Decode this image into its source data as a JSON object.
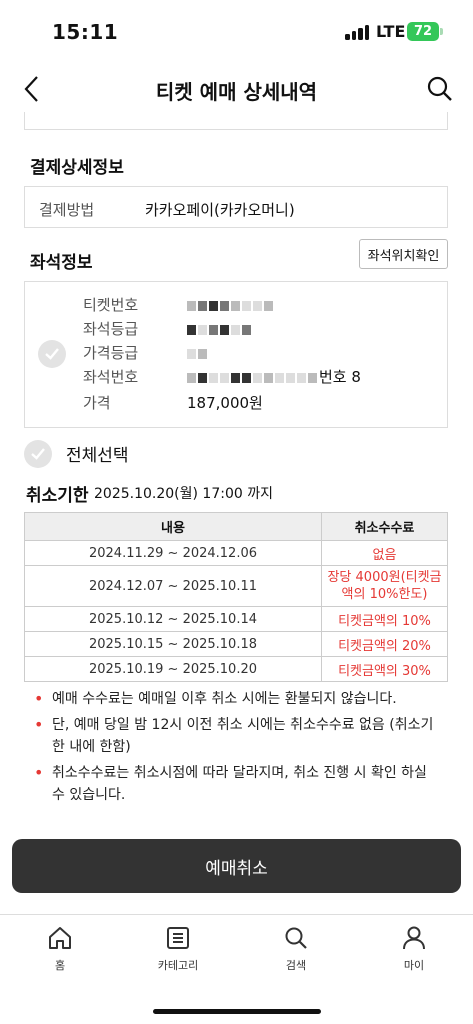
{
  "status": {
    "time": "15:11",
    "network": "LTE",
    "battery": "72"
  },
  "header": {
    "title": "티켓 예매 상세내역"
  },
  "payment": {
    "section_title": "결제상세정보",
    "method_label": "결제방법",
    "method_value": "카카오페이(카카오머니)"
  },
  "seat": {
    "section_title": "좌석정보",
    "seat_position_button": "좌석위치확인",
    "rows": {
      "ticket_no_label": "티켓번호",
      "grade_label": "좌석등급",
      "price_grade_label": "가격등급",
      "seat_no_label": "좌석번호",
      "seat_no_suffix": "번호 8",
      "price_label": "가격",
      "price_value": "187,000원"
    }
  },
  "select_all": {
    "label": "전체선택"
  },
  "deadline": {
    "title": "취소기한",
    "value": "2025.10.20(월) 17:00 까지"
  },
  "fee_table": {
    "headers": [
      "내용",
      "취소수수료"
    ],
    "rows": [
      {
        "period": "2024.11.29 ~ 2024.12.06",
        "fee": "없음"
      },
      {
        "period": "2024.12.07 ~ 2025.10.11",
        "fee": "장당 4000원(티켓금액의 10%한도)"
      },
      {
        "period": "2025.10.12 ~ 2025.10.14",
        "fee": "티켓금액의 10%"
      },
      {
        "period": "2025.10.15 ~ 2025.10.18",
        "fee": "티켓금액의 20%"
      },
      {
        "period": "2025.10.19 ~ 2025.10.20",
        "fee": "티켓금액의 30%"
      }
    ]
  },
  "notes": [
    "예매 수수료는 예매일 이후 취소 시에는 환불되지 않습니다.",
    "단, 예매 당일 밤 12시 이전 취소 시에는 취소수수료 없음 (취소기한 내에 한함)",
    "취소수수료는 취소시점에 따라 달라지며, 취소 진행 시 확인 하실 수 있습니다."
  ],
  "cancel_button": "예매취소",
  "tabbar": [
    {
      "label": "홈",
      "icon": "home-icon"
    },
    {
      "label": "카테고리",
      "icon": "list-icon"
    },
    {
      "label": "검색",
      "icon": "search-icon"
    },
    {
      "label": "마이",
      "icon": "person-icon"
    }
  ],
  "colors": {
    "accent_red": "#e53935",
    "button_dark": "#333333",
    "battery_green": "#34c759"
  }
}
